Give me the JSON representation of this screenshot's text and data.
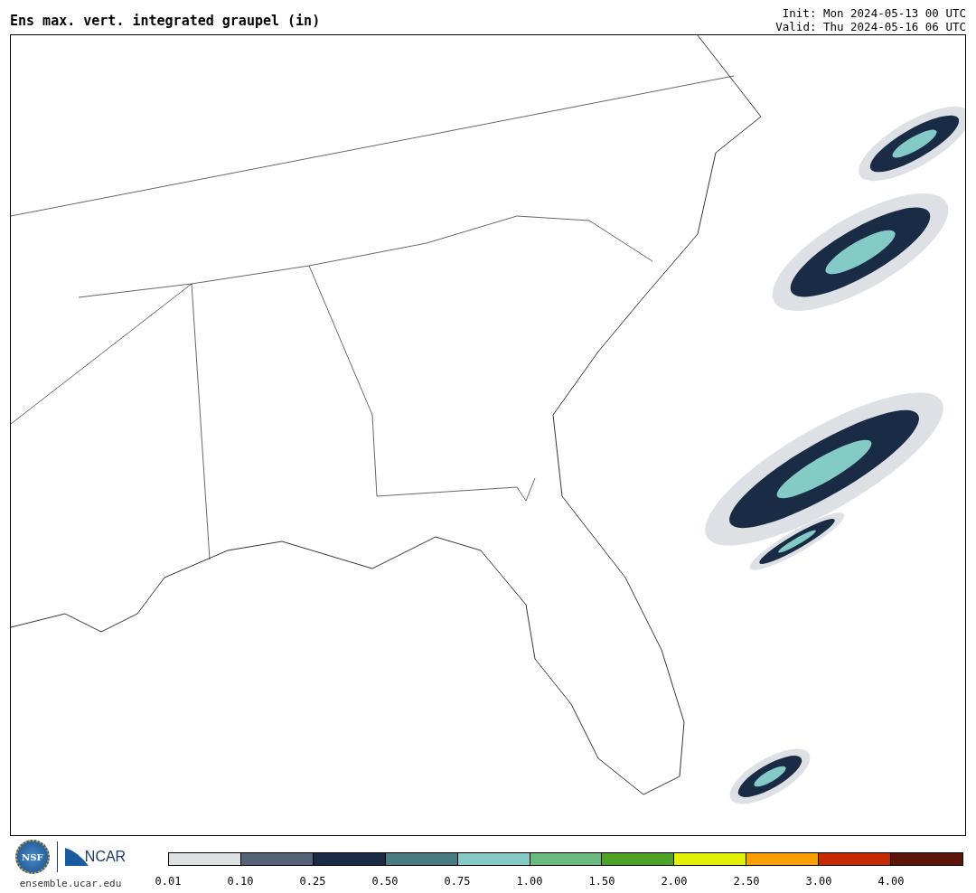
{
  "title": "Ens max. vert. integrated graupel (in)",
  "init": "Init: Mon 2024-05-13 00 UTC",
  "valid": "Valid: Thu 2024-05-16 06 UTC",
  "logos": {
    "nsf": "NSF",
    "ncar": "NCAR",
    "url": "ensemble.ucar.edu"
  },
  "colorbar": [
    {
      "color": "#dde1e5",
      "label": "0.01"
    },
    {
      "color": "#53637a",
      "label": "0.10"
    },
    {
      "color": "#1a2b45",
      "label": "0.25"
    },
    {
      "color": "#4a7b83",
      "label": "0.50"
    },
    {
      "color": "#84cbc8",
      "label": "0.75"
    },
    {
      "color": "#6abb80",
      "label": "1.00"
    },
    {
      "color": "#4fa228",
      "label": "1.50"
    },
    {
      "color": "#e2f000",
      "label": "2.00"
    },
    {
      "color": "#fb9e00",
      "label": "2.50"
    },
    {
      "color": "#c62a00",
      "label": "3.00"
    },
    {
      "color": "#5e1409",
      "label": "4.00"
    }
  ]
}
